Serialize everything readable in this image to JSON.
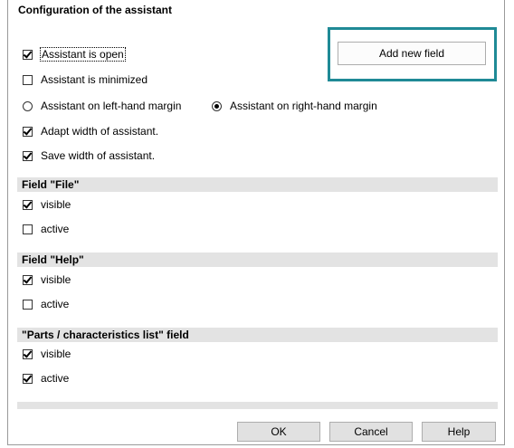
{
  "dialog": {
    "title": "Configuration of the assistant",
    "add_field_label": "Add new field"
  },
  "assistant_options": {
    "open": {
      "label": "Assistant is open",
      "checked": true
    },
    "minimized": {
      "label": "Assistant is minimized",
      "checked": false
    },
    "left_margin": {
      "label": "Assistant on left-hand margin",
      "selected": false
    },
    "right_margin": {
      "label": "Assistant on right-hand margin",
      "selected": true
    },
    "adapt_width": {
      "label": "Adapt width of assistant.",
      "checked": true
    },
    "save_width": {
      "label": "Save width of assistant.",
      "checked": true
    }
  },
  "sections": [
    {
      "title": "Field \"File\"",
      "visible": {
        "label": "visible",
        "checked": true
      },
      "active": {
        "label": "active",
        "checked": false
      }
    },
    {
      "title": "Field \"Help\"",
      "visible": {
        "label": "visible",
        "checked": true
      },
      "active": {
        "label": "active",
        "checked": false
      }
    },
    {
      "title": "\"Parts / characteristics list\" field",
      "visible": {
        "label": "visible",
        "checked": true
      },
      "active": {
        "label": "active",
        "checked": true
      }
    }
  ],
  "footer": {
    "ok_label": "OK",
    "cancel_label": "Cancel",
    "help_label": "Help"
  }
}
